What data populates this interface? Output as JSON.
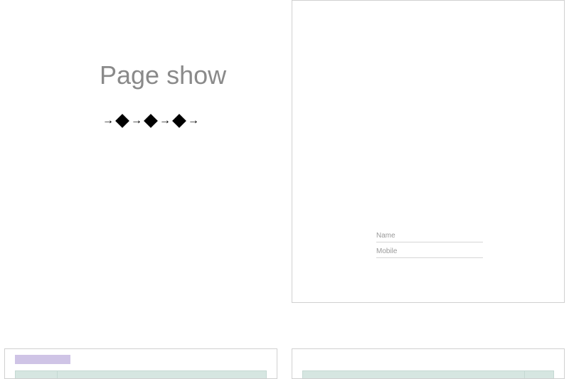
{
  "title": "Page show",
  "form": {
    "fields": [
      {
        "label": "Name"
      },
      {
        "label": "Mobile"
      }
    ]
  }
}
